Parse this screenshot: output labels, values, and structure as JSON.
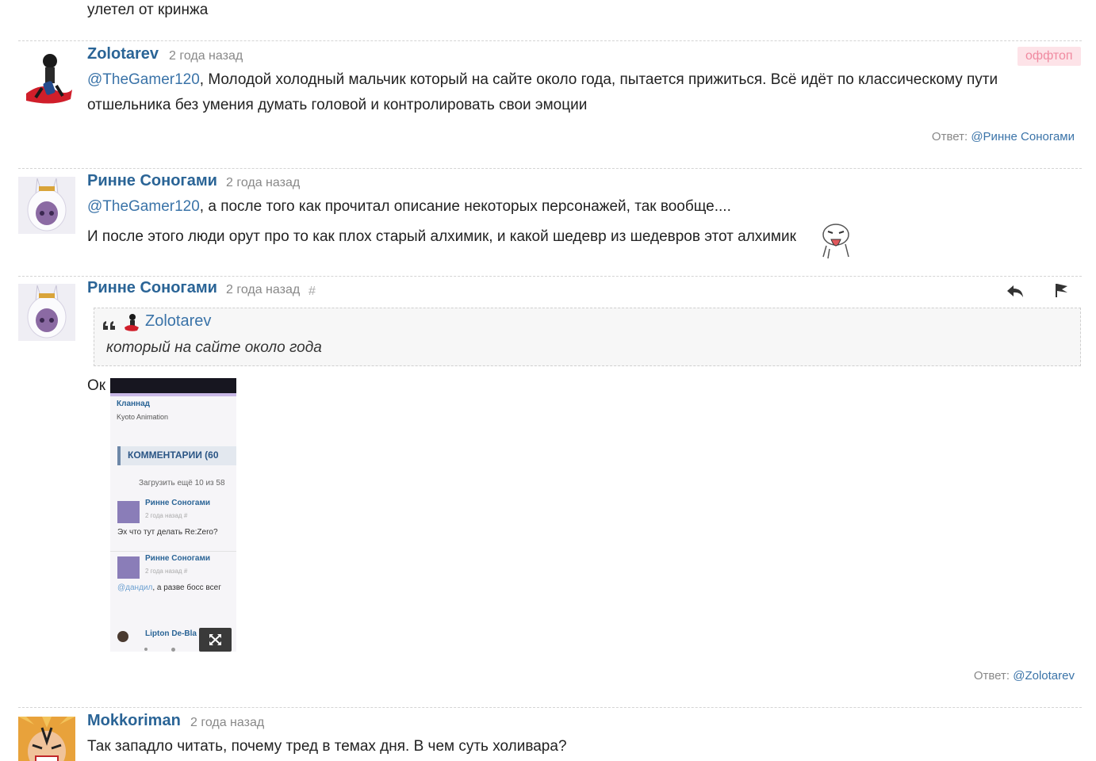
{
  "top_fragment": "улетел от кринжа",
  "comments": [
    {
      "author": "Zolotarev",
      "time": "2 года назад",
      "tag": "оффтоп",
      "mention": "@TheGamer120",
      "line1": ", Молодой холодный мальчик который на сайте около года, пытается прижиться. Всё идёт по классическому пути",
      "line2": "отшельника без умения думать головой и контролировать свои эмоции",
      "reply_label": "Ответ:",
      "reply_to": "@Ринне Соногами"
    },
    {
      "author": "Ринне Соногами",
      "time": "2 года назад",
      "mention": "@TheGamer120",
      "line1": ", а после того как прочитал описание некоторых персонажей, так вообще....",
      "line2": "И после этого люди орут про то как плох старый алхимик, и какой шедевр из шедевров этот алхимик"
    },
    {
      "author": "Ринне Соногами",
      "time": "2 года назад",
      "hash": "#",
      "quote_author": "Zolotarev",
      "quote_text": "который на сайте около года",
      "text": "Ок",
      "reply_label": "Ответ:",
      "reply_to": "@Zolotarev",
      "screenshot": {
        "title": "Кланнад",
        "studio": "Kyoto Animation",
        "section": "КОММЕНТАРИИ (60",
        "load_more": "Загрузить ещё 10 из 58",
        "c1_author": "Ринне Соногами",
        "c1_time": "2 года назад  #",
        "c1_text": "Эх что тут делать Re:Zero?",
        "c2_author": "Ринне Соногами",
        "c2_time": "2 года назад  #",
        "c2_mention": "@дандил",
        "c2_text": ", а разве босс всег",
        "c3_author": "Lipton De-Bla"
      }
    },
    {
      "author": "Mokkoriman",
      "time": "2 года назад",
      "text": "Так западло читать, почему тред в темах дня. В чем суть холивара?"
    }
  ],
  "icons": [
    "reply-icon",
    "flag-icon",
    "quote-icon",
    "expand-icon",
    "meme-sticker"
  ],
  "colors": {
    "link": "#2a6496",
    "mention": "#3a73a8",
    "meta": "#888888",
    "tag_bg": "#fde3e8",
    "tag_fg": "#f08aa0"
  }
}
